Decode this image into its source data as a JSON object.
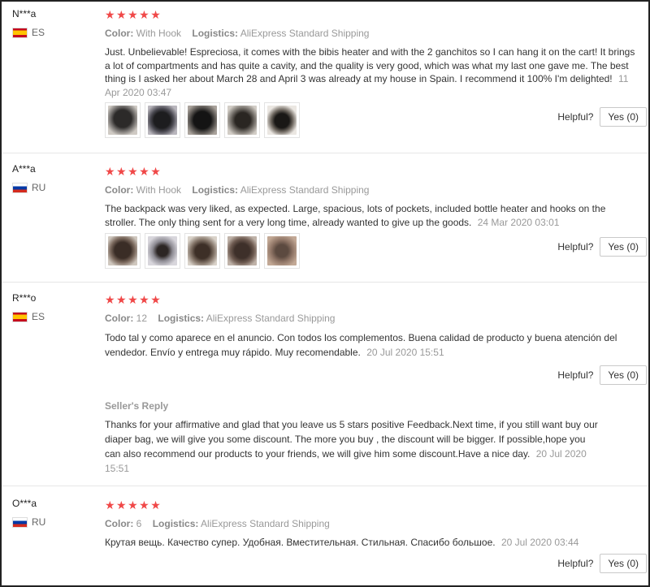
{
  "labels": {
    "color": "Color:",
    "logistics": "Logistics:",
    "helpful": "Helpful?",
    "yes_button": "Yes (0)",
    "sellers_reply": "Seller's Reply"
  },
  "colors": {
    "stars": "#f04848"
  },
  "reviews": [
    {
      "user": "N***a",
      "country": "ES",
      "flag_icon": "spain-flag-icon",
      "stars": "★★★★★",
      "color_value": "With Hook",
      "logistics_value": "AliExpress Standard Shipping",
      "text": "Just. Unbelievable! Espreciosa, it comes with the bibis heater and with the 2 ganchitos so I can hang it on the cart! It brings a lot of compartments and has quite a cavity, and the quality is very good, which was what my last one gave me. The best thing is I asked her about March 28 and April 3 was already at my house in Spain. I recommend it 100% I'm delighted!",
      "date": "11 Apr 2020 03:47",
      "photo_count": 5
    },
    {
      "user": "A***a",
      "country": "RU",
      "flag_icon": "russia-flag-icon",
      "stars": "★★★★★",
      "color_value": "With Hook",
      "logistics_value": "AliExpress Standard Shipping",
      "text": "The backpack was very liked, as expected. Large, spacious, lots of pockets, included bottle heater and hooks on the stroller. The only thing sent for a very long time, already wanted to give up the goods.",
      "date": "24 Mar 2020 03:01",
      "photo_count": 5
    },
    {
      "user": "R***o",
      "country": "ES",
      "flag_icon": "spain-flag-icon",
      "stars": "★★★★★",
      "color_value": "12",
      "logistics_value": "AliExpress Standard Shipping",
      "text": "Todo tal y como aparece en el anuncio. Con todos los complementos. Buena calidad de producto y buena atención del vendedor. Envío y entrega muy rápido. Muy recomendable.",
      "date": "20 Jul 2020 15:51",
      "reply_text": "Thanks for your affirmative and glad that you leave us 5 stars positive Feedback.Next time, if you still want buy our diaper bag, we will give you some discount. The more you buy , the discount will be bigger. If possible,hope you can also recommend our products to your friends, we will give him some discount.Have a nice day.",
      "reply_date": "20 Jul 2020 15:51"
    },
    {
      "user": "O***a",
      "country": "RU",
      "flag_icon": "russia-flag-icon",
      "stars": "★★★★★",
      "color_value": "6",
      "logistics_value": "AliExpress Standard Shipping",
      "text": "Крутая вещь. Качество супер. Удобная. Вместительная. Стильная. Спасибо большое.",
      "date": "20 Jul 2020 03:44"
    }
  ]
}
